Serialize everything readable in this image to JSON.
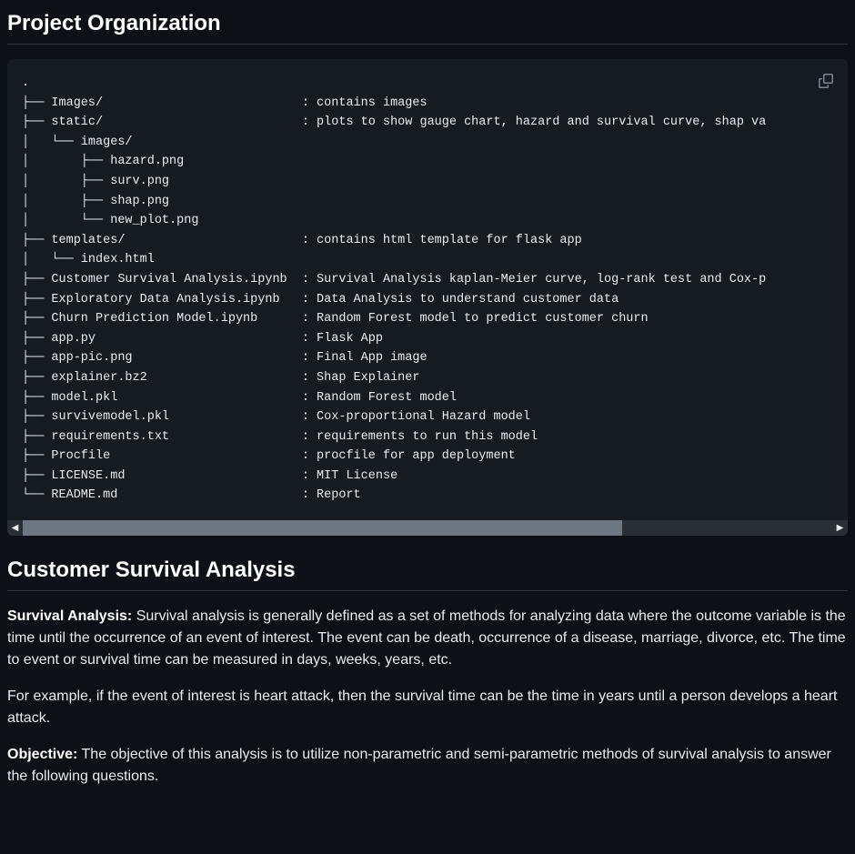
{
  "heading1": "Project Organization",
  "codeText": ".\n├── Images/                           : contains images\n├── static/                           : plots to show gauge chart, hazard and survival curve, shap va\n│   └── images/\n│       ├── hazard.png\n│       ├── surv.png\n│       ├── shap.png\n│       └── new_plot.png\n├── templates/                        : contains html template for flask app\n│   └── index.html\n├── Customer Survival Analysis.ipynb  : Survival Analysis kaplan-Meier curve, log-rank test and Cox-p\n├── Exploratory Data Analysis.ipynb   : Data Analysis to understand customer data\n├── Churn Prediction Model.ipynb      : Random Forest model to predict customer churn\n├── app.py                            : Flask App\n├── app-pic.png                       : Final App image\n├── explainer.bz2                     : Shap Explainer\n├── model.pkl                         : Random Forest model\n├── survivemodel.pkl                  : Cox-proportional Hazard model\n├── requirements.txt                  : requirements to run this model\n├── Procfile                          : procfile for app deployment\n├── LICENSE.md                        : MIT License\n└── README.md                         : Report",
  "heading2": "Customer Survival Analysis",
  "para1": {
    "bold": "Survival Analysis:",
    "text": " Survival analysis is generally defined as a set of methods for analyzing data where the outcome variable is the time until the occurrence of an event of interest. The event can be death, occurrence of a disease, marriage, divorce, etc. The time to event or survival time can be measured in days, weeks, years, etc."
  },
  "para2": "For example, if the event of interest is heart attack, then the survival time can be the time in years until a person develops a heart attack.",
  "para3": {
    "bold": "Objective:",
    "text": " The objective of this analysis is to utilize non-parametric and semi-parametric methods of survival analysis to answer the following questions."
  },
  "scroll": {
    "leftArrow": "◀",
    "rightArrow": "▶"
  }
}
